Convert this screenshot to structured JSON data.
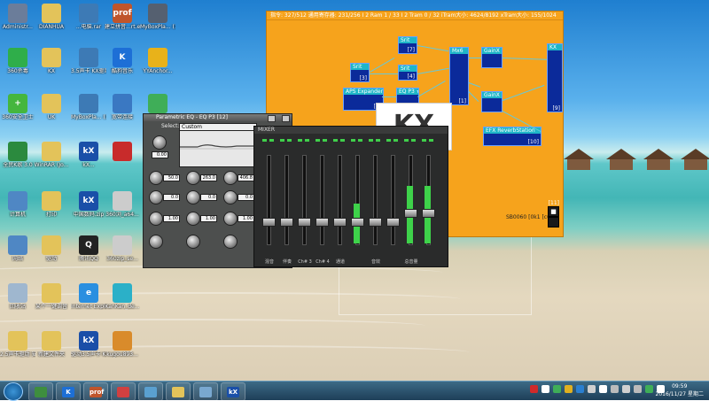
{
  "desktop_icons": [
    {
      "label": "Administr...",
      "color": "#6b7d9a",
      "glyph": "",
      "col": 0,
      "row": 0
    },
    {
      "label": "DIANHUA",
      "color": "#e3c35a",
      "glyph": "",
      "col": 1,
      "row": 0
    },
    {
      "label": "...电脑.rar",
      "color": "#3d7ab5",
      "glyph": "",
      "col": 2,
      "row": 0
    },
    {
      "label": "建立拼音...rt.exe",
      "color": "#c0552b",
      "glyph": "prof",
      "col": 3,
      "row": 0
    },
    {
      "label": "MyBoxPla... (1).exe",
      "color": "#556070",
      "glyph": "",
      "col": 4,
      "row": 0
    },
    {
      "label": "360杀毒",
      "color": "#2fae4a",
      "glyph": "",
      "col": 0,
      "row": 1
    },
    {
      "label": "KX",
      "color": "#e3c35a",
      "glyph": "",
      "col": 1,
      "row": 1
    },
    {
      "label": "3.5声卡 KX驱动...",
      "color": "#3d7ab5",
      "glyph": "",
      "col": 2,
      "row": 1
    },
    {
      "label": "酷狗音乐",
      "color": "#1d6fd6",
      "glyph": "K",
      "col": 3,
      "row": 1
    },
    {
      "label": "YYAnchor...",
      "color": "#e8b21a",
      "glyph": "",
      "col": 4,
      "row": 1
    },
    {
      "label": "360安全卫士",
      "color": "#45b63e",
      "glyph": "+",
      "col": 0,
      "row": 2
    },
    {
      "label": "UK",
      "color": "#e3c35a",
      "glyph": "",
      "col": 1,
      "row": 2
    },
    {
      "label": "MyBoxPla... (1)...",
      "color": "#3d7ab5",
      "glyph": "",
      "col": 2,
      "row": 2
    },
    {
      "label": "宽带连接",
      "color": "#3a78c2",
      "glyph": "",
      "col": 3,
      "row": 2
    },
    {
      "label": "",
      "color": "#3fae58",
      "glyph": "",
      "col": 4,
      "row": 2
    },
    {
      "label": "全民K歌 3.0",
      "color": "#2b8a3e",
      "glyph": "",
      "col": 0,
      "row": 3
    },
    {
      "label": "WinRAR (Jo...",
      "color": "#e3c35a",
      "glyph": "",
      "col": 1,
      "row": 3
    },
    {
      "label": "kX...",
      "color": "#1a4fa8",
      "glyph": "kX",
      "col": 2,
      "row": 3
    },
    {
      "label": "",
      "color": "#c82b2b",
      "glyph": "",
      "col": 3,
      "row": 3
    },
    {
      "label": "计算机",
      "color": "#4f87c4",
      "glyph": "",
      "col": 0,
      "row": 4
    },
    {
      "label": "打印",
      "color": "#e3c35a",
      "glyph": "",
      "col": 1,
      "row": 4
    },
    {
      "label": "中国数码.zip",
      "color": "#1a4fa8",
      "glyph": "kX",
      "col": 2,
      "row": 4
    },
    {
      "label": "360浏_a64...",
      "color": "#cccccc",
      "glyph": "",
      "col": 3,
      "row": 4
    },
    {
      "label": "网络",
      "color": "#4f87c4",
      "glyph": "",
      "col": 0,
      "row": 5
    },
    {
      "label": "驱动",
      "color": "#e3c35a",
      "glyph": "",
      "col": 1,
      "row": 5
    },
    {
      "label": "腾讯QQ",
      "color": "#222222",
      "glyph": "Q",
      "col": 2,
      "row": 5
    },
    {
      "label": "360zip_se...",
      "color": "#cccccc",
      "glyph": "",
      "col": 3,
      "row": 5
    },
    {
      "label": "回收站",
      "color": "#9fb7cf",
      "glyph": "",
      "col": 0,
      "row": 6
    },
    {
      "label": "某个一键调音",
      "color": "#e3c35a",
      "glyph": "",
      "col": 1,
      "row": 6
    },
    {
      "label": "Internet Explorer",
      "color": "#2a8fe0",
      "glyph": "e",
      "col": 2,
      "row": 6
    },
    {
      "label": "KanKan_de...",
      "color": "#2bb0c8",
      "glyph": "",
      "col": 3,
      "row": 6
    },
    {
      "label": "2.5声卡驱动 安装说明",
      "color": "#e3c35a",
      "glyph": "",
      "col": 0,
      "row": 7
    },
    {
      "label": "新建文件夹",
      "color": "#e3c35a",
      "glyph": "",
      "col": 1,
      "row": 7
    },
    {
      "label": "驱动3.5声卡 KX驱动...",
      "color": "#1a4fa8",
      "glyph": "kX",
      "col": 2,
      "row": 7
    },
    {
      "label": "kugou893...",
      "color": "#d98b2b",
      "glyph": "",
      "col": 3,
      "row": 7
    }
  ],
  "dsp_window": {
    "title_status": "指令: 327/512  通用寄存器: 231/256  I 2 Ram 1 / 33  I 2 Tram 0 / 32 iTram大小: 4624/8192  xTram大小: 155/1024",
    "footer_label": "SB0060 [0k1 [c000]",
    "blocks": [
      {
        "name": "Srit",
        "num": "[3]"
      },
      {
        "name": "Srit",
        "num": "[7]"
      },
      {
        "name": "Srit",
        "num": "[4]"
      },
      {
        "name": "Mx6",
        "num": "[1]"
      },
      {
        "name": "GainX [7]",
        "num": ""
      },
      {
        "name": "GainX [8]",
        "num": ""
      },
      {
        "name": "KX",
        "num": "[9]"
      },
      {
        "name": "APS Expander",
        "num": "[4]"
      },
      {
        "name": "EQ P3 ★",
        "num": ""
      },
      {
        "name": "EFX ReverbStation",
        "num": "[10]"
      },
      {
        "name": "",
        "num": "[11]"
      }
    ]
  },
  "eq_window": {
    "title": "Parametric EQ - EQ P3 [12]",
    "preset_label": "Select:",
    "preset_value": "Custom",
    "bands": [
      {
        "freq": "50.0",
        "gain": "0.0",
        "q": "1.00"
      },
      {
        "freq": "263.0",
        "gain": "0.0",
        "q": "1.00"
      },
      {
        "freq": "406.8",
        "gain": "0.0",
        "q": "1.00"
      }
    ],
    "master_gain": "0.00"
  },
  "mixer_window": {
    "title": "MIXER",
    "strips": [
      {
        "label": "混音",
        "level": 0.0,
        "fader": 0.25
      },
      {
        "label": "伴奏",
        "level": 0.0,
        "fader": 0.25
      },
      {
        "label": "Ch# 3",
        "level": 0.0,
        "fader": 0.25
      },
      {
        "label": "Ch# 4",
        "level": 0.0,
        "fader": 0.25
      },
      {
        "label": "通道",
        "level": 0.0,
        "fader": 0.25
      },
      {
        "label": "",
        "level": 0.45,
        "fader": 0.25
      },
      {
        "label": "音效",
        "level": 0.0,
        "fader": 0.25
      },
      {
        "label": "",
        "level": 0.0,
        "fader": 0.25
      },
      {
        "label": "总音量",
        "level": 0.65,
        "fader": 0.35
      },
      {
        "label": "",
        "level": 0.65,
        "fader": 0.35
      }
    ]
  },
  "taskbar": {
    "buttons": [
      {
        "name": "360-browser",
        "color": "#3e8e3e",
        "glyph": ""
      },
      {
        "name": "kugou",
        "color": "#1d6fd6",
        "glyph": "K"
      },
      {
        "name": "professor",
        "color": "#c0552b",
        "glyph": "prof"
      },
      {
        "name": "media",
        "color": "#d04040",
        "glyph": ""
      },
      {
        "name": "display",
        "color": "#5aa0d0",
        "glyph": ""
      },
      {
        "name": "folder",
        "color": "#e3c35a",
        "glyph": ""
      },
      {
        "name": "window",
        "color": "#79a8d0",
        "glyph": ""
      },
      {
        "name": "kx-mixer",
        "color": "#1a4fa8",
        "glyph": "kX"
      }
    ],
    "tray_colors": [
      "#d02a2a",
      "#ffffff",
      "#3fae58",
      "#e0b020",
      "#2a7fd0",
      "#d0d0d0",
      "#ffffff",
      "#bbbbbb",
      "#d0d0d0",
      "#bbbbbb",
      "#3fae58",
      "#ffffff"
    ],
    "time": "09:59",
    "date": "2016/11/27 星期二"
  }
}
